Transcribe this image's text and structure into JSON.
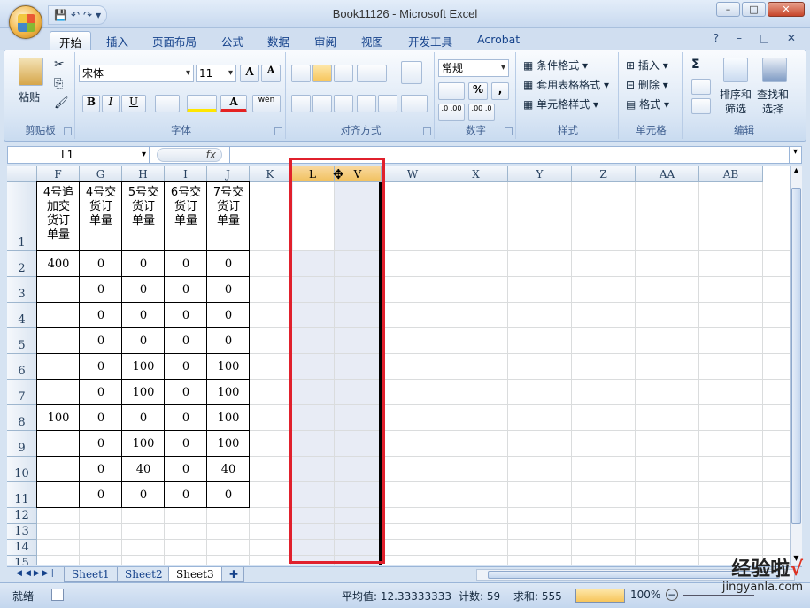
{
  "window": {
    "title": "Book11126 - Microsoft Excel",
    "minimize": "–",
    "restore": "□",
    "close": "✕"
  },
  "qat": {
    "save": "💾",
    "undo": "↶",
    "redo": "↷",
    "customize": "▾"
  },
  "ribbon_tabs": [
    "开始",
    "插入",
    "页面布局",
    "公式",
    "数据",
    "审阅",
    "视图",
    "开发工具",
    "Acrobat"
  ],
  "ribbon_right": "? – □ ✕",
  "clipboard": {
    "paste": "粘贴",
    "label": "剪贴板"
  },
  "font": {
    "name": "宋体",
    "size": "11",
    "label": "字体",
    "bold": "B",
    "italic": "I",
    "underline": "U",
    "grow": "A",
    "shrink": "A",
    "color": "A",
    "wen": "wén"
  },
  "alignment": {
    "label": "对齐方式"
  },
  "number": {
    "format": "常规",
    "percent": "%",
    "comma": ",",
    "label": "数字",
    "inc": ".0 .00",
    "dec": ".00 .0"
  },
  "styles": {
    "conditional": "条件格式",
    "table": "套用表格格式",
    "cell": "单元格样式",
    "label": "样式"
  },
  "cells": {
    "insert": "插入",
    "delete": "删除",
    "format": "格式",
    "label": "单元格"
  },
  "editing": {
    "sigma": "Σ",
    "sort": "排序和\n筛选",
    "find": "查找和\n选择",
    "sort1": "排序和",
    "sort2": "筛选",
    "find1": "查找和",
    "find2": "选择",
    "label": "编辑"
  },
  "formula_bar": {
    "name_box": "L1",
    "fx": "fx",
    "value": ""
  },
  "columns": [
    "F",
    "G",
    "H",
    "I",
    "J",
    "K",
    "L",
    "V",
    "W",
    "X",
    "Y",
    "Z",
    "AA",
    "AB"
  ],
  "rows": [
    "1",
    "2",
    "3",
    "4",
    "5",
    "6",
    "7",
    "8",
    "9",
    "10",
    "11",
    "12",
    "13",
    "14",
    "15"
  ],
  "header_row": [
    "4号追加交货订单量",
    "4号交货订单量",
    "5号交货订单量",
    "6号交货订单量",
    "7号交货订单量"
  ],
  "header_lines": [
    [
      "4号追",
      "加交",
      "货订",
      "单量"
    ],
    [
      "4号交",
      "货订",
      "单量"
    ],
    [
      "5号交",
      "货订",
      "单量"
    ],
    [
      "6号交",
      "货订",
      "单量"
    ],
    [
      "7号交",
      "货订",
      "单量"
    ]
  ],
  "table": [
    [
      "400",
      "0",
      "0",
      "0",
      "0"
    ],
    [
      "",
      "0",
      "0",
      "0",
      "0"
    ],
    [
      "",
      "0",
      "0",
      "0",
      "0"
    ],
    [
      "",
      "0",
      "0",
      "0",
      "0"
    ],
    [
      "",
      "0",
      "100",
      "0",
      "100"
    ],
    [
      "",
      "0",
      "100",
      "0",
      "100"
    ],
    [
      "100",
      "0",
      "0",
      "0",
      "100"
    ],
    [
      "",
      "0",
      "100",
      "0",
      "100"
    ],
    [
      "",
      "0",
      "40",
      "0",
      "40"
    ],
    [
      "",
      "0",
      "0",
      "0",
      "0"
    ]
  ],
  "sheet_tabs": [
    "Sheet1",
    "Sheet2",
    "Sheet3"
  ],
  "status": {
    "ready": "就绪",
    "average": "平均值: 12.33333333",
    "count": "计数: 59",
    "sum": "求和: 555",
    "zoom": "100%"
  },
  "watermark": {
    "line1": "经验啦",
    "check": "√",
    "line2": "jingyanla.com"
  },
  "colors": {
    "highlight_box": "#e0202c",
    "selected_header": "#f1c15f"
  }
}
